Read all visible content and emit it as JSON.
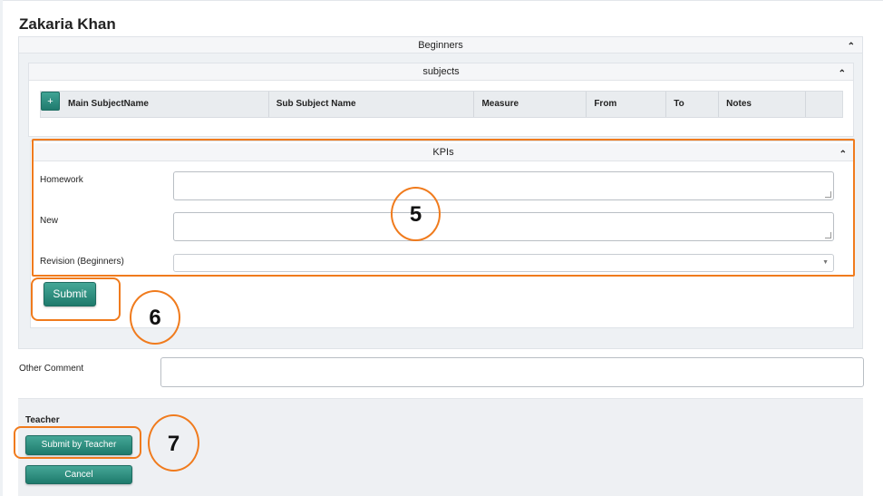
{
  "page": {
    "student_name": "Zakaria Khan"
  },
  "beginners_panel": {
    "title": "Beginners",
    "collapse_icon": "chevron-up-icon"
  },
  "subjects_panel": {
    "title": "subjects",
    "add_button_label": "+",
    "columns": [
      "Main SubjectName",
      "Sub Subject Name",
      "Measure",
      "From",
      "To",
      "Notes",
      ""
    ]
  },
  "kpis_panel": {
    "title": "KPIs",
    "fields": [
      {
        "label": "Homework",
        "value": ""
      },
      {
        "label": "New",
        "value": ""
      },
      {
        "label": "Revision (Beginners)",
        "value": ""
      }
    ],
    "submit_label": "Submit"
  },
  "other_comment": {
    "label": "Other Comment",
    "value": ""
  },
  "teacher": {
    "label": "Teacher",
    "submit_label": "Submit by Teacher",
    "cancel_label": "Cancel"
  },
  "annotations": {
    "kpis_marker": "5",
    "submit_marker": "6",
    "teacher_marker": "7",
    "color": "#f07b1d"
  },
  "colors": {
    "accent": "#2a8a7b",
    "annotation": "#f07b1d"
  }
}
